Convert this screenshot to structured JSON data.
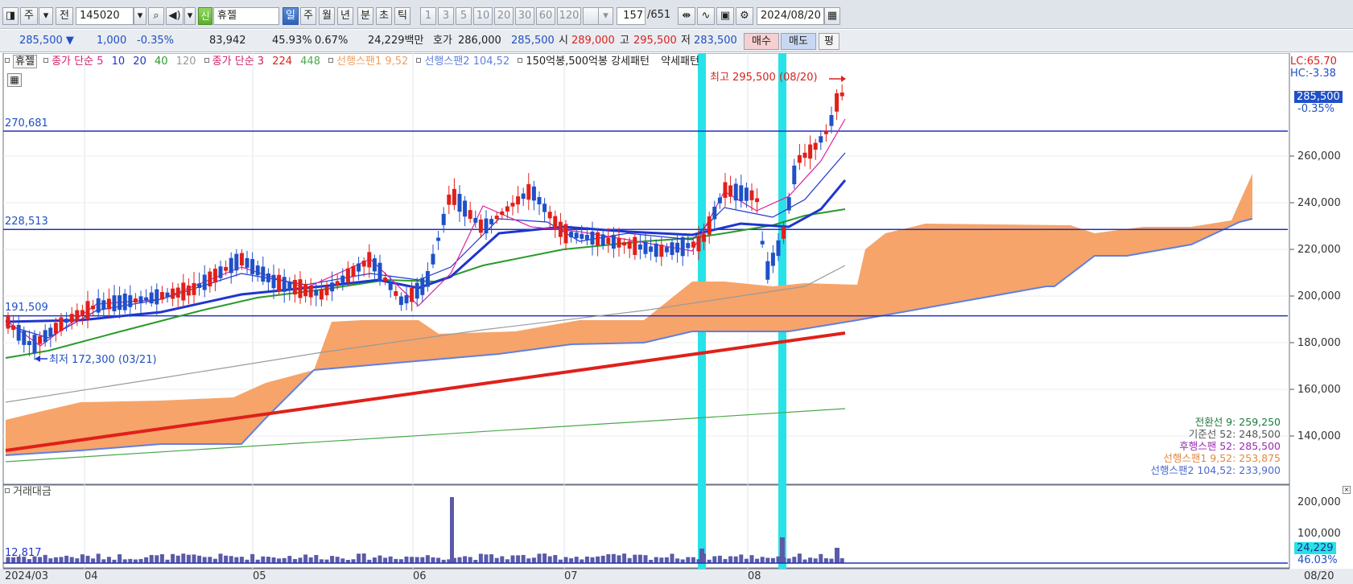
{
  "toolbar": {
    "market": "주",
    "prev": "전",
    "code": "145020",
    "name_badge": "신",
    "name": "휴젤",
    "periods": [
      "일",
      "주",
      "월",
      "년",
      "분",
      "초",
      "틱"
    ],
    "intervals": [
      "1",
      "3",
      "5",
      "10",
      "20",
      "30",
      "60",
      "120"
    ],
    "count": "157",
    "total": "/651",
    "date": "2024/08/20"
  },
  "quote": {
    "price": "285,500 ▼",
    "change": "1,000",
    "change_pct": "-0.35%",
    "volume": "83,942",
    "volume_ratio": "45.93%",
    "turnover_pct": "0.67%",
    "amount": "24,229백만",
    "ask_label": "호가",
    "ask": "286,000",
    "bid": "285,500",
    "open_label": "시",
    "open": "289,000",
    "high_label": "고",
    "high": "295,500",
    "low_label": "저",
    "low": "283,500",
    "buy": "매수",
    "sell": "매도",
    "eval": "평"
  },
  "legend": {
    "name": "휴젤",
    "ma_label_a": "종가 단순",
    "ma_a": [
      "5",
      "10",
      "20",
      "40",
      "120"
    ],
    "ma_label_b": "종가 단순",
    "ma_b": [
      "3",
      "224",
      "448"
    ],
    "span1": "선행스팬1 9,52",
    "span2": "선행스팬2 104,52",
    "pattern": "150억봉,500억봉 강세패턴",
    "pattern2": "약세패턴"
  },
  "colors": {
    "ma5": "#e0209a",
    "ma10": "#1f35d0",
    "ma20": "#1f35d0",
    "ma40": "#2a9a2a",
    "ma120": "#9a9a9a",
    "ma3": "#d0206a",
    "ma224": "#e0201a",
    "ma448": "#4aa84a",
    "span1": "#f0a060",
    "span2": "#6080e0",
    "up": "#e0201a",
    "down": "#1f50c8",
    "highlight": "#27e2e8"
  },
  "chart_data": {
    "type": "candlestick",
    "x_tick_labels": [
      "2024/03",
      "04",
      "05",
      "06",
      "07",
      "08"
    ],
    "y_tick_labels": [
      "260,000",
      "240,000",
      "220,000",
      "200,000",
      "180,000",
      "160,000",
      "140,000"
    ],
    "ylim": [
      125000,
      300000
    ],
    "horizontal_lines": [
      "270,681",
      "228,513",
      "191,509"
    ],
    "current_price_tag": "285,500",
    "current_pct_tag": "-0.35%",
    "high_annotation": "최고 295,500 (08/20)",
    "low_annotation": "최저 172,300 (03/21)",
    "lc": "LC:65.70",
    "hc": "HC:-3.38",
    "ichimoku": [
      {
        "label": "전환선 9: 259,250",
        "color": "#1a7a3a"
      },
      {
        "label": "기준선 52: 248,500",
        "color": "#555555"
      },
      {
        "label": "후행스팬 52: 285,500",
        "color": "#9a2ab0"
      },
      {
        "label": "선행스팬1 9,52: 253,875",
        "color": "#e08a40"
      },
      {
        "label": "선행스팬2 104,52: 233,900",
        "color": "#4a6ad0"
      }
    ],
    "end_date": "08/20"
  },
  "volume_pane": {
    "title": "거래대금",
    "left_value": "12,817",
    "y_tick_labels": [
      "200,000",
      "100,000"
    ],
    "tag_amount": "24,229",
    "tag_pct": "46.03%"
  }
}
